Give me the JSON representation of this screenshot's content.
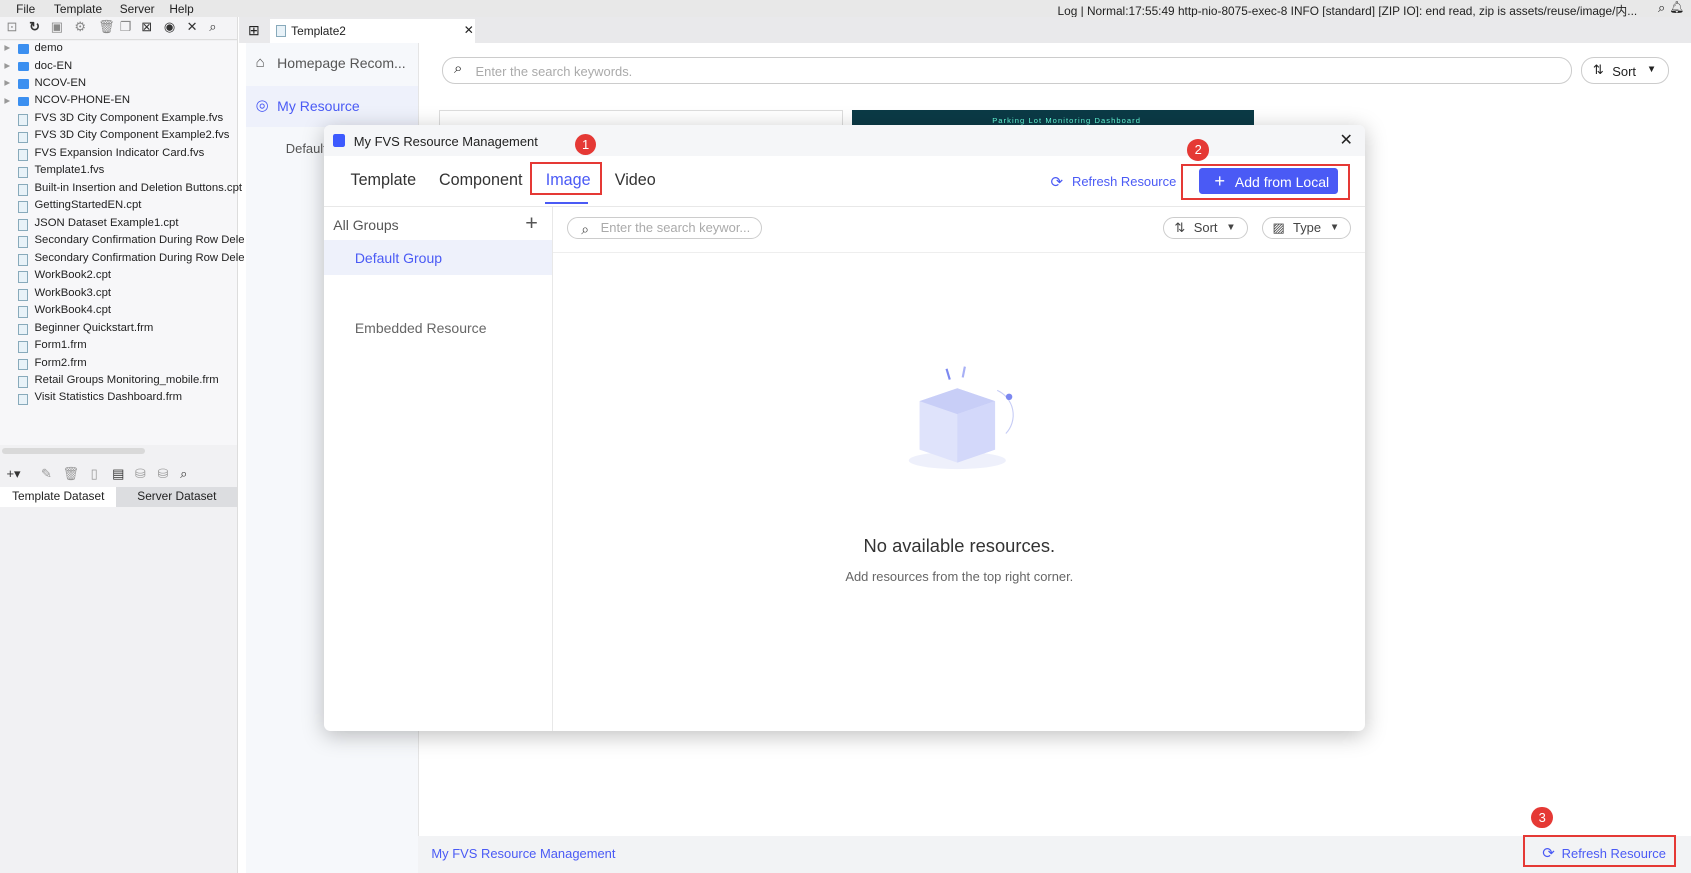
{
  "menu": [
    "File",
    "Template",
    "Server",
    "Help"
  ],
  "log": "Log | Normal:17:55:49 http-nio-8075-exec-8 INFO [standard] [ZIP IO]: end read, zip is assets/reuse/image/内...",
  "tree": [
    {
      "label": "demo",
      "type": "folder"
    },
    {
      "label": "doc-EN",
      "type": "folder"
    },
    {
      "label": "NCOV-EN",
      "type": "folder"
    },
    {
      "label": "NCOV-PHONE-EN",
      "type": "folder"
    },
    {
      "label": "FVS 3D City Component Example.fvs",
      "type": "file"
    },
    {
      "label": "FVS 3D City Component Example2.fvs",
      "type": "file"
    },
    {
      "label": "FVS Expansion Indicator Card.fvs",
      "type": "file"
    },
    {
      "label": "Template1.fvs",
      "type": "file"
    },
    {
      "label": "Built-in Insertion and Deletion Buttons.cpt",
      "type": "file"
    },
    {
      "label": "GettingStartedEN.cpt",
      "type": "file"
    },
    {
      "label": "JSON Dataset Example1.cpt",
      "type": "file"
    },
    {
      "label": "Secondary Confirmation During Row Dele",
      "type": "file"
    },
    {
      "label": "Secondary Confirmation During Row Dele",
      "type": "file"
    },
    {
      "label": "WorkBook2.cpt",
      "type": "file"
    },
    {
      "label": "WorkBook3.cpt",
      "type": "file"
    },
    {
      "label": "WorkBook4.cpt",
      "type": "file"
    },
    {
      "label": "Beginner Quickstart.frm",
      "type": "file"
    },
    {
      "label": "Form1.frm",
      "type": "file"
    },
    {
      "label": "Form2.frm",
      "type": "file"
    },
    {
      "label": "Retail Groups Monitoring_mobile.frm",
      "type": "file"
    },
    {
      "label": "Visit Statistics Dashboard.frm",
      "type": "file"
    }
  ],
  "dataset_tabs": [
    "Template Dataset",
    "Server Dataset"
  ],
  "editor_tab": "Template2",
  "side": {
    "homepage": "Homepage Recom...",
    "my_resource": "My Resource",
    "default": "Default"
  },
  "search_placeholder": "Enter the search keywords.",
  "sort": "Sort",
  "thumb_title": "Parking Lot Monitoring Dashboard",
  "bottom": {
    "link": "My FVS Resource Management",
    "refresh": "Refresh Resource"
  },
  "modal": {
    "title": "My FVS Resource Management",
    "tabs": [
      "Template",
      "Component",
      "Image",
      "Video"
    ],
    "active_tab": "Image",
    "refresh": "Refresh Resource",
    "add": "Add from Local",
    "all_groups": "All Groups",
    "groups": [
      "Default Group",
      "Embedded Resource"
    ],
    "search_placeholder": "Enter the search keywor...",
    "sort": "Sort",
    "type": "Type",
    "empty_title": "No available resources.",
    "empty_sub": "Add resources from the top right corner."
  },
  "badges": [
    "1",
    "2",
    "3"
  ],
  "colors": {
    "accent": "#4a5af5",
    "annotation": "#e53935"
  }
}
